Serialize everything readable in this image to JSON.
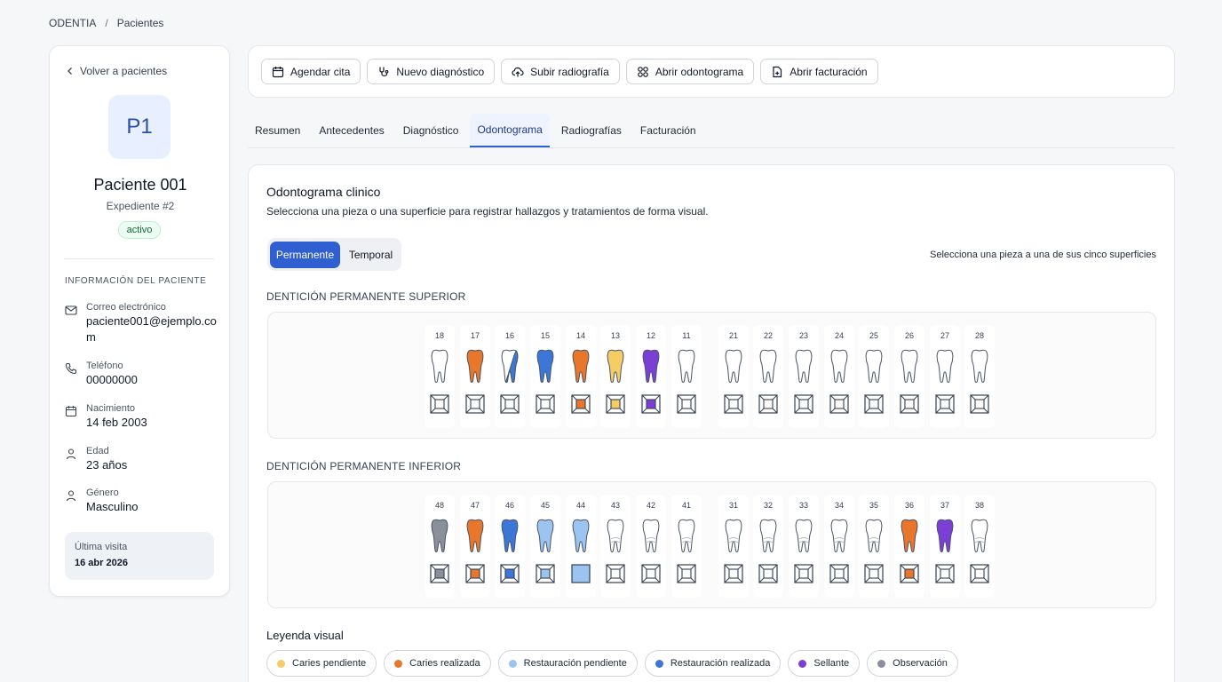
{
  "breadcrumb": {
    "root": "ODENTIA",
    "sep": "/",
    "current": "Pacientes"
  },
  "patient": {
    "back_label": "Volver a pacientes",
    "initials": "P1",
    "name": "Paciente 001",
    "record": "Expediente #2",
    "status": "activo",
    "section_title": "INFORMACIÓN DEL PACIENTE",
    "fields": [
      {
        "label": "Correo electrónico",
        "value": "paciente001@ejemplo.com",
        "icon": "mail-icon"
      },
      {
        "label": "Teléfono",
        "value": "00000000",
        "icon": "phone-icon"
      },
      {
        "label": "Nacimiento",
        "value": "14 feb 2003",
        "icon": "calendar-icon"
      },
      {
        "label": "Edad",
        "value": "23 años",
        "icon": "person-icon"
      },
      {
        "label": "Género",
        "value": "Masculino",
        "icon": "person-icon"
      }
    ],
    "last_visit": {
      "label": "Última visita",
      "value": "16 abr 2026"
    }
  },
  "actions": [
    {
      "label": "Agendar cita",
      "icon": "calendar-icon"
    },
    {
      "label": "Nuevo diagnóstico",
      "icon": "stethoscope-icon"
    },
    {
      "label": "Subir radiografía",
      "icon": "upload-cloud-icon"
    },
    {
      "label": "Abrir odontograma",
      "icon": "tooth-icon"
    },
    {
      "label": "Abrir facturación",
      "icon": "file-plus-icon"
    }
  ],
  "tabs": [
    {
      "label": "Resumen",
      "active": false
    },
    {
      "label": "Antecedentes",
      "active": false
    },
    {
      "label": "Diagnóstico",
      "active": false
    },
    {
      "label": "Odontograma",
      "active": true
    },
    {
      "label": "Radiografías",
      "active": false
    },
    {
      "label": "Facturación",
      "active": false
    }
  ],
  "odontogram": {
    "title": "Odontograma clinico",
    "subtitle": "Selecciona una pieza o una superficie para registrar hallazgos y tratamientos de forma visual.",
    "toggle": {
      "permanent": "Permanente",
      "temporary": "Temporal",
      "selected": "Permanente"
    },
    "hint": "Selecciona una pieza a una de sus cinco superficies",
    "upper": {
      "title": "DENTICIÓN PERMANENTE SUPERIOR",
      "teeth": [
        {
          "n": "18",
          "c": null,
          "s": null
        },
        {
          "n": "17",
          "c": "#e8762b",
          "s": null
        },
        {
          "n": "16",
          "c": "half",
          "s": null
        },
        {
          "n": "15",
          "c": "#3c76d6",
          "s": null
        },
        {
          "n": "14",
          "c": "#e8762b",
          "s": "#e8762b"
        },
        {
          "n": "13",
          "c": "#f6cc64",
          "s": "#f6cc64"
        },
        {
          "n": "12",
          "c": "#7b3fd6",
          "s": "#7b3fd6"
        },
        {
          "n": "11",
          "c": null,
          "s": null
        },
        {
          "n": "21",
          "c": null,
          "s": null
        },
        {
          "n": "22",
          "c": null,
          "s": null
        },
        {
          "n": "23",
          "c": null,
          "s": null
        },
        {
          "n": "24",
          "c": null,
          "s": null
        },
        {
          "n": "25",
          "c": null,
          "s": null
        },
        {
          "n": "26",
          "c": null,
          "s": null
        },
        {
          "n": "27",
          "c": null,
          "s": null
        },
        {
          "n": "28",
          "c": null,
          "s": null
        }
      ]
    },
    "lower": {
      "title": "DENTICIÓN PERMANENTE INFERIOR",
      "teeth": [
        {
          "n": "48",
          "c": "#8a8f99",
          "s": "#8a8f99"
        },
        {
          "n": "47",
          "c": "#e8762b",
          "s": "#e8762b"
        },
        {
          "n": "46",
          "c": "#3c76d6",
          "s": "#3c76d6"
        },
        {
          "n": "45",
          "c": "#9cc4f0",
          "s": "#9cc4f0"
        },
        {
          "n": "44",
          "c": "#9cc4f0",
          "s": "full"
        },
        {
          "n": "43",
          "c": null,
          "s": null
        },
        {
          "n": "42",
          "c": null,
          "s": null
        },
        {
          "n": "41",
          "c": null,
          "s": null
        },
        {
          "n": "31",
          "c": null,
          "s": null
        },
        {
          "n": "32",
          "c": null,
          "s": null
        },
        {
          "n": "33",
          "c": null,
          "s": null
        },
        {
          "n": "34",
          "c": null,
          "s": null
        },
        {
          "n": "35",
          "c": null,
          "s": null
        },
        {
          "n": "36",
          "c": "#e8762b",
          "s": "#e8762b"
        },
        {
          "n": "37",
          "c": "#7b3fd6",
          "s": null
        },
        {
          "n": "38",
          "c": null,
          "s": null
        }
      ]
    },
    "legend_title": "Leyenda visual",
    "legend": [
      {
        "label": "Caries pendiente",
        "color": "#f6cc64"
      },
      {
        "label": "Caries realizada",
        "color": "#e8762b"
      },
      {
        "label": "Restauración pendiente",
        "color": "#9cc4f0"
      },
      {
        "label": "Restauración realizada",
        "color": "#3c76d6"
      },
      {
        "label": "Sellante",
        "color": "#7b3fd6"
      },
      {
        "label": "Observación",
        "color": "#8a8f99"
      }
    ]
  }
}
